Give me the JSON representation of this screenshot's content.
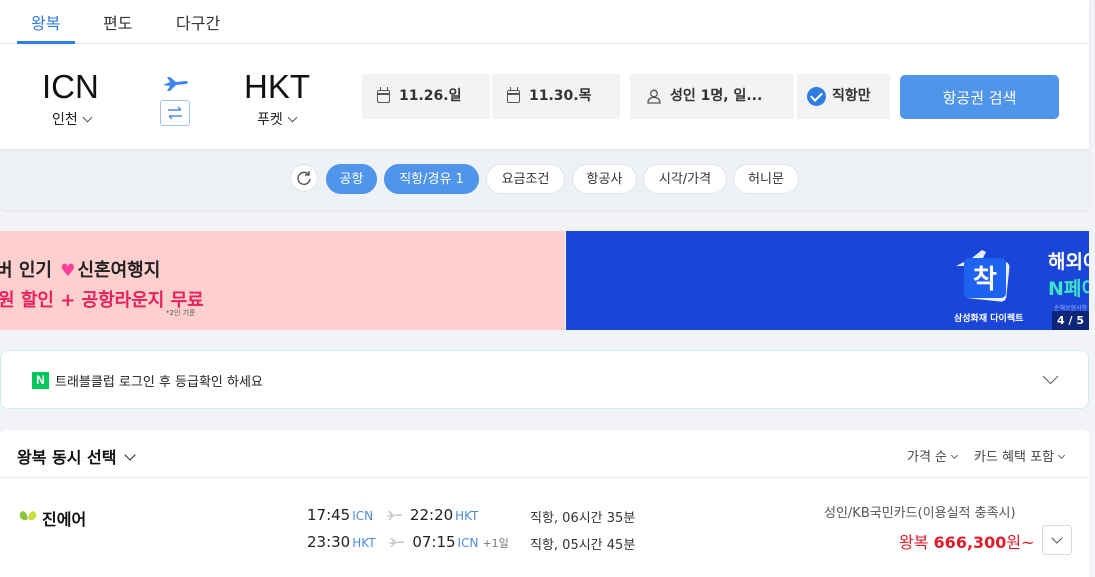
{
  "tabs": [
    {
      "label": "왕복",
      "active": true
    },
    {
      "label": "편도",
      "active": false
    },
    {
      "label": "다구간",
      "active": false
    }
  ],
  "route": {
    "origin_code": "ICN",
    "origin_name": "인천",
    "dest_code": "HKT",
    "dest_name": "푸켓"
  },
  "search": {
    "depart_date": "11.26.일",
    "return_date": "11.30.목",
    "passengers": "성인 1명, 일...",
    "direct_only_label": "직항만",
    "search_button": "항공권 검색"
  },
  "filters": [
    "공항",
    "직항/경유 1",
    "요금조건",
    "항공사",
    "시각/가격",
    "허니문"
  ],
  "banners": {
    "left_line1a": "버 인기",
    "left_line1b": "신혼여행지",
    "left_line2": "원 할인 + 공항라운지 무료",
    "left_footnote": "*2인 기준",
    "right_badge": "착",
    "right_caption": "삼성화재 다이렉트",
    "right_head1": "해외여",
    "right_head2": "N페이",
    "right_tiny": "순해보험사항",
    "pager": "4 / 5"
  },
  "login": {
    "badge": "N",
    "text": "트래블클럽 로그인 후 등급확인 하세요"
  },
  "results": {
    "title": "왕복 동시 선택",
    "sort_price": "가격 순",
    "sort_card": "카드 혜택 포함",
    "flights": [
      {
        "airline": "진에어",
        "outbound": {
          "dep_time": "17:45",
          "dep_code": "ICN",
          "arr_time": "22:20",
          "arr_code": "HKT",
          "plus": "",
          "duration": "직항, 06시간 35분"
        },
        "inbound": {
          "dep_time": "23:30",
          "dep_code": "HKT",
          "arr_time": "07:15",
          "arr_code": "ICN",
          "plus": "+1일",
          "duration": "직항, 05시간 45분"
        },
        "card_condition": "성인/KB국민카드(이용실적 충족시)",
        "price_prefix": "왕복",
        "price": "666,300",
        "price_suffix": "원~"
      }
    ]
  },
  "colors": {
    "accent": "#2f7de1",
    "button": "#4f95ea",
    "price": "#e01c2a",
    "banner_pink": "#fdcfcf",
    "banner_blue": "#1a45d9"
  }
}
